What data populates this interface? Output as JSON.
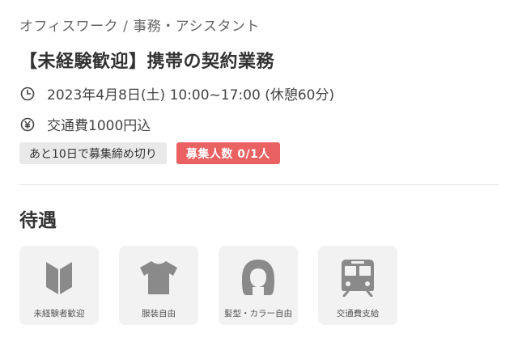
{
  "header": {
    "category": "オフィスワーク / 事務・アシスタント",
    "title": "【未経験歓迎】携帯の契約業務"
  },
  "details": {
    "datetime": "2023年4月8日(土) 10:00~17:00 (休憩60分)",
    "transport": "交通費1000円込",
    "icons": [
      "clock-icon",
      "yen-icon"
    ]
  },
  "badges": {
    "deadline": "あと10日で募集締め切り",
    "quota": "募集人数 0/1人"
  },
  "colors": {
    "accent": "#ea6162",
    "icon_gray": "#8a8a8a",
    "tile_bg": "#f2f2f2"
  },
  "benefits": {
    "title": "待遇",
    "items": [
      {
        "label": "未経験者歓迎",
        "icon": "beginner-mark-icon"
      },
      {
        "label": "服装自由",
        "icon": "tshirt-icon"
      },
      {
        "label": "髪型・カラー自由",
        "icon": "hair-icon"
      },
      {
        "label": "交通費支給",
        "icon": "train-icon"
      }
    ]
  }
}
